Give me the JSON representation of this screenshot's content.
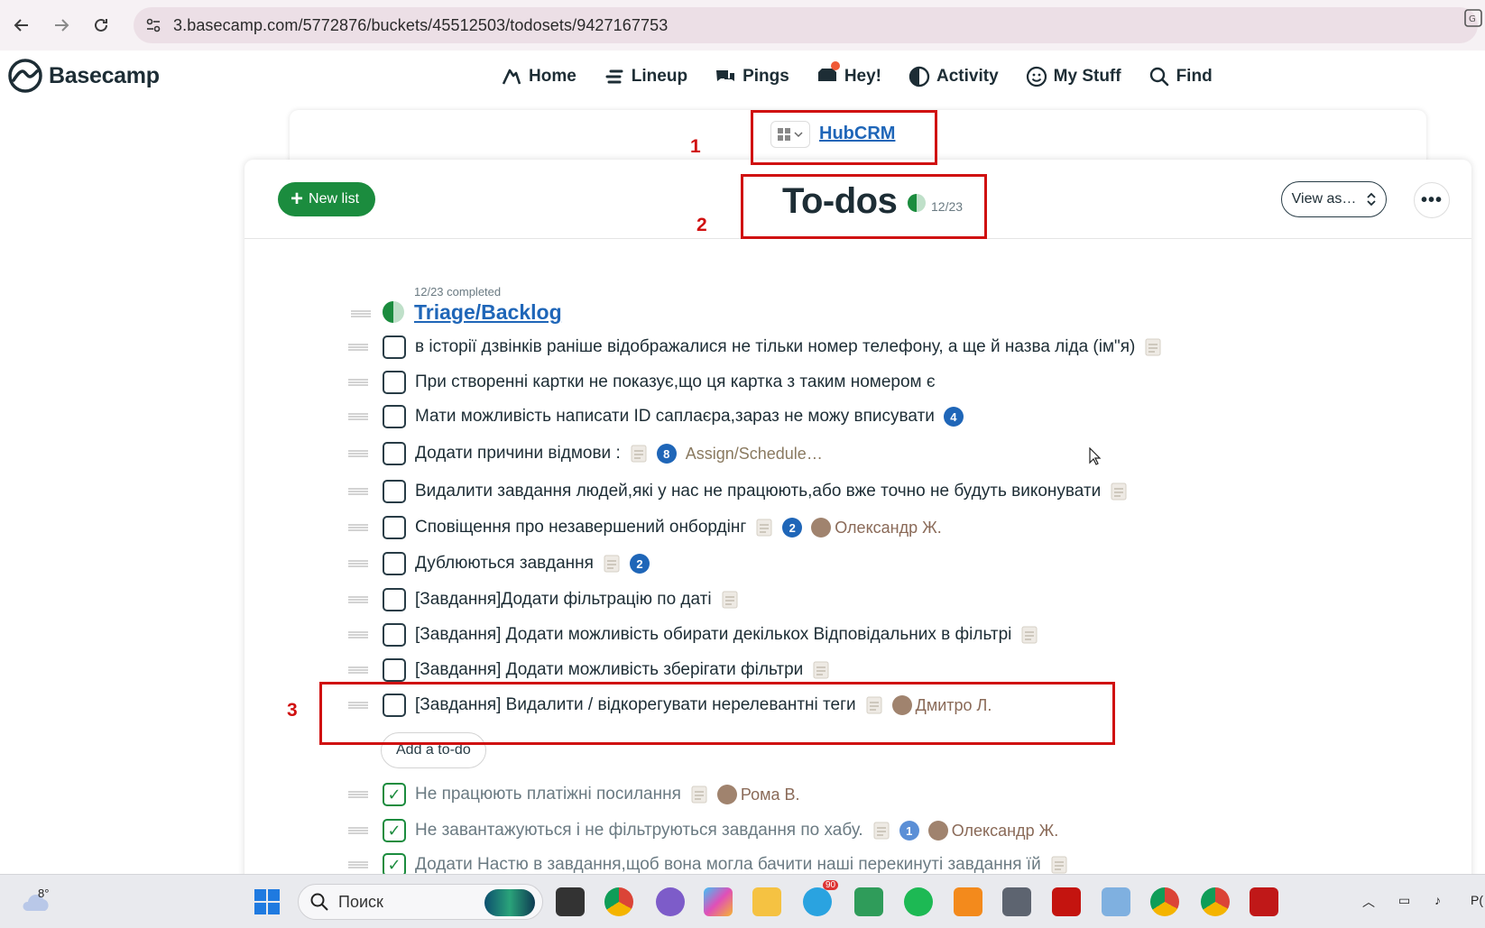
{
  "browser": {
    "url": "3.basecamp.com/5772876/buckets/45512503/todosets/9427167753"
  },
  "app": {
    "logo_text": "Basecamp",
    "nav": [
      {
        "label": "Home",
        "icon": "home-icon"
      },
      {
        "label": "Lineup",
        "icon": "lineup-icon"
      },
      {
        "label": "Pings",
        "icon": "pings-icon"
      },
      {
        "label": "Hey!",
        "icon": "hey-icon"
      },
      {
        "label": "Activity",
        "icon": "activity-icon"
      },
      {
        "label": "My Stuff",
        "icon": "my-stuff-icon"
      },
      {
        "label": "Find",
        "icon": "search-icon"
      }
    ]
  },
  "project": {
    "name": "HubCRM"
  },
  "page": {
    "new_list_label": "New list",
    "title": "To-dos",
    "count": "12/23",
    "view_as_label": "View as…"
  },
  "list": {
    "meta": "12/23 completed",
    "title": "Triage/Backlog",
    "progress": 0.52,
    "open_items": [
      {
        "text": "в історії дзвінків раніше відображалися не тільки номер телефону, а ще й назва ліда (ім\"я)",
        "note": true
      },
      {
        "text": "При створенні картки не показує,що ця картка з таким номером є",
        "note": false
      },
      {
        "text": "Мати можливість написати ID саплаєра,зараз не можу вписувати",
        "note": false,
        "badge": "4"
      },
      {
        "text": "Додати причини відмови :",
        "note": true,
        "badge": "8",
        "assign": "Assign/Schedule…"
      },
      {
        "text": "Видалити завдання людей,які у нас не працюють,або вже точно не будуть виконувати",
        "note": true
      },
      {
        "text": "Сповіщення про незавершений онбордінг",
        "note": true,
        "badge": "2",
        "assignee": "Олександр Ж."
      },
      {
        "text": "Дублюються завдання",
        "note": true,
        "badge": "2"
      },
      {
        "text": "[Завдання]Додати фільтрацію по даті",
        "note": true
      },
      {
        "text": "[Завдання] Додати можливість обирати декількох Відповідальних в фільтрі",
        "note": true
      },
      {
        "text": "[Завдання] Додати можливість зберігати фільтри",
        "note": true
      },
      {
        "text": "[Завдання] Видалити / відкорегувати нерелевантні теги",
        "note": true,
        "assignee": "Дмитро Л."
      }
    ],
    "add_todo_label": "Add a to-do",
    "done_items": [
      {
        "text": "Не працюють платіжні посилання",
        "note": true,
        "assignee": "Рома В."
      },
      {
        "text": "Не завантажуються і не фільтруються завдання по хабу.",
        "note": true,
        "badge": "1",
        "assignee": "Олександр Ж."
      },
      {
        "text": "Додати Настю в завдання,щоб вона могла бачити наші перекинуті завдання їй",
        "note": true
      }
    ]
  },
  "annotations": [
    "1",
    "2",
    "3"
  ],
  "taskbar": {
    "weather_temp": "8°",
    "search_placeholder": "Поиск",
    "telegram_badge": "90",
    "tray_text": "Р("
  },
  "colors": {
    "accent_green": "#1b8c3e",
    "link_blue": "#1f66b8",
    "annotation_red": "#d01010"
  }
}
